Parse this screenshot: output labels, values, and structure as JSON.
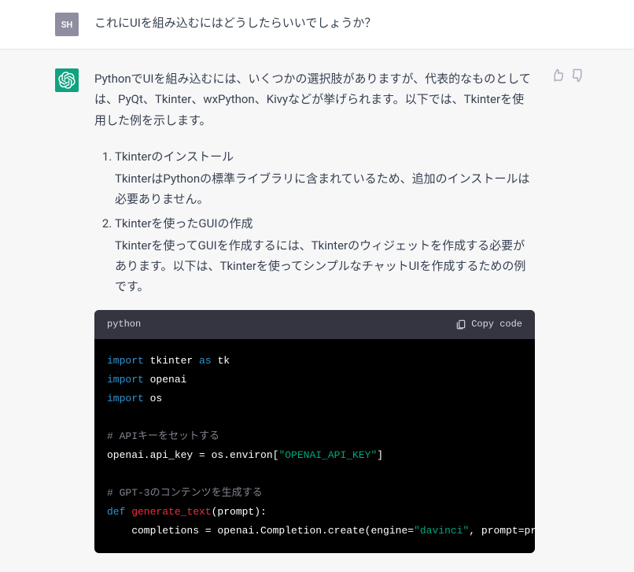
{
  "user": {
    "avatar_label": "SH",
    "message": "これにUIを組み込むにはどうしたらいいでしょうか？"
  },
  "assistant": {
    "intro": "PythonでUIを組み込むには、いくつかの選択肢がありますが、代表的なものとしては、PyQt、Tkinter、wxPython、Kivyなどが挙げられます。以下では、Tkinterを使用した例を示します。",
    "list": [
      {
        "title": "Tkinterのインストール",
        "desc": "TkinterはPythonの標準ライブラリに含まれているため、追加のインストールは必要ありません。"
      },
      {
        "title": "Tkinterを使ったGUIの作成",
        "desc": "Tkinterを使ってGUIを作成するには、Tkinterのウィジェットを作成する必要があります。以下は、Tkinterを使ってシンプルなチャットUIを作成するための例です。"
      }
    ]
  },
  "code": {
    "language": "python",
    "copy_label": "Copy code",
    "tokens": {
      "import1": "import",
      "tkinter": " tkinter ",
      "as": "as",
      "tk": " tk",
      "import2": "import",
      "openai": " openai",
      "import3": "import",
      "os": " os",
      "comment1": "# APIキーをセットする",
      "line_api": "openai.api_key = os.environ[",
      "string_api": "\"OPENAI_API_KEY\"",
      "line_api_close": "]",
      "comment2": "# GPT-3のコンテンツを生成する",
      "def": "def",
      "funcname": " generate_text",
      "params": "(prompt):",
      "last_indent": "    completions = openai.Completion.create(engine=",
      "last_string": "\"davinci\"",
      "last_rest": ", prompt=prompt, m"
    }
  }
}
